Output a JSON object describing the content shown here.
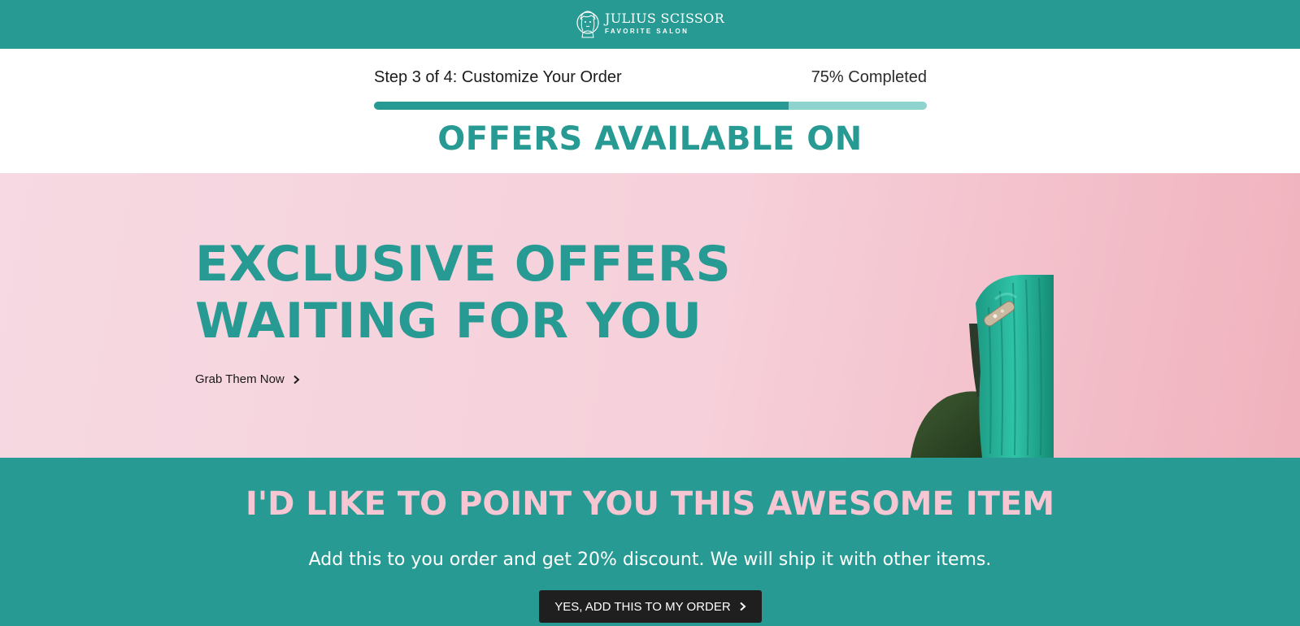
{
  "header": {
    "brand_name": "JULIUS SCISSOR",
    "brand_tagline": "FAVORITE SALON",
    "logo_icon": "face-illustration-icon",
    "background_color": "#279a93"
  },
  "progress": {
    "step_label": "Step 3 of 4: Customize Your Order",
    "completed_label": "75% Completed",
    "percent": 75,
    "fill_color": "#279a93",
    "track_color": "#8fd3cf"
  },
  "offers": {
    "title": "OFFERS AVAILABLE ON"
  },
  "hero": {
    "title_line1": "EXCLUSIVE OFFERS",
    "title_line2": "WAITING FOR YOU",
    "cta_label": "Grab Them Now",
    "cta_icon": "chevron-right-icon",
    "image": "model-green-hair-with-clip"
  },
  "upsell": {
    "title": "I'D LIKE TO POINT YOU THIS AWESOME ITEM",
    "subtitle": "Add this to you order and get 20% discount. We will ship it with other items.",
    "button_label": "YES, ADD THIS TO MY ORDER",
    "button_icon": "chevron-right-icon",
    "title_color": "#f6c6d3",
    "button_color": "#1f1f1f"
  }
}
